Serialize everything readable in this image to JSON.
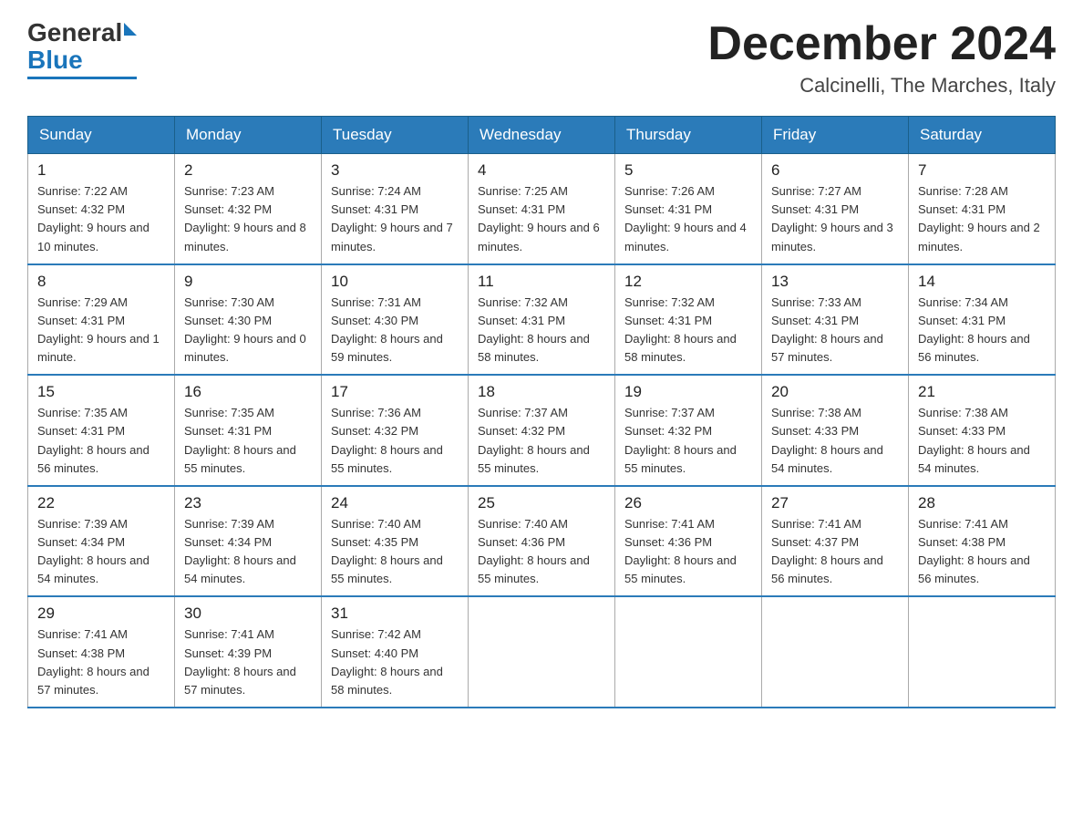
{
  "header": {
    "logo_general": "General",
    "logo_blue": "Blue",
    "month_year": "December 2024",
    "location": "Calcinelli, The Marches, Italy"
  },
  "days_of_week": [
    "Sunday",
    "Monday",
    "Tuesday",
    "Wednesday",
    "Thursday",
    "Friday",
    "Saturday"
  ],
  "weeks": [
    [
      {
        "day": 1,
        "sunrise": "7:22 AM",
        "sunset": "4:32 PM",
        "daylight": "9 hours and 10 minutes."
      },
      {
        "day": 2,
        "sunrise": "7:23 AM",
        "sunset": "4:32 PM",
        "daylight": "9 hours and 8 minutes."
      },
      {
        "day": 3,
        "sunrise": "7:24 AM",
        "sunset": "4:31 PM",
        "daylight": "9 hours and 7 minutes."
      },
      {
        "day": 4,
        "sunrise": "7:25 AM",
        "sunset": "4:31 PM",
        "daylight": "9 hours and 6 minutes."
      },
      {
        "day": 5,
        "sunrise": "7:26 AM",
        "sunset": "4:31 PM",
        "daylight": "9 hours and 4 minutes."
      },
      {
        "day": 6,
        "sunrise": "7:27 AM",
        "sunset": "4:31 PM",
        "daylight": "9 hours and 3 minutes."
      },
      {
        "day": 7,
        "sunrise": "7:28 AM",
        "sunset": "4:31 PM",
        "daylight": "9 hours and 2 minutes."
      }
    ],
    [
      {
        "day": 8,
        "sunrise": "7:29 AM",
        "sunset": "4:31 PM",
        "daylight": "9 hours and 1 minute."
      },
      {
        "day": 9,
        "sunrise": "7:30 AM",
        "sunset": "4:30 PM",
        "daylight": "9 hours and 0 minutes."
      },
      {
        "day": 10,
        "sunrise": "7:31 AM",
        "sunset": "4:30 PM",
        "daylight": "8 hours and 59 minutes."
      },
      {
        "day": 11,
        "sunrise": "7:32 AM",
        "sunset": "4:31 PM",
        "daylight": "8 hours and 58 minutes."
      },
      {
        "day": 12,
        "sunrise": "7:32 AM",
        "sunset": "4:31 PM",
        "daylight": "8 hours and 58 minutes."
      },
      {
        "day": 13,
        "sunrise": "7:33 AM",
        "sunset": "4:31 PM",
        "daylight": "8 hours and 57 minutes."
      },
      {
        "day": 14,
        "sunrise": "7:34 AM",
        "sunset": "4:31 PM",
        "daylight": "8 hours and 56 minutes."
      }
    ],
    [
      {
        "day": 15,
        "sunrise": "7:35 AM",
        "sunset": "4:31 PM",
        "daylight": "8 hours and 56 minutes."
      },
      {
        "day": 16,
        "sunrise": "7:35 AM",
        "sunset": "4:31 PM",
        "daylight": "8 hours and 55 minutes."
      },
      {
        "day": 17,
        "sunrise": "7:36 AM",
        "sunset": "4:32 PM",
        "daylight": "8 hours and 55 minutes."
      },
      {
        "day": 18,
        "sunrise": "7:37 AM",
        "sunset": "4:32 PM",
        "daylight": "8 hours and 55 minutes."
      },
      {
        "day": 19,
        "sunrise": "7:37 AM",
        "sunset": "4:32 PM",
        "daylight": "8 hours and 55 minutes."
      },
      {
        "day": 20,
        "sunrise": "7:38 AM",
        "sunset": "4:33 PM",
        "daylight": "8 hours and 54 minutes."
      },
      {
        "day": 21,
        "sunrise": "7:38 AM",
        "sunset": "4:33 PM",
        "daylight": "8 hours and 54 minutes."
      }
    ],
    [
      {
        "day": 22,
        "sunrise": "7:39 AM",
        "sunset": "4:34 PM",
        "daylight": "8 hours and 54 minutes."
      },
      {
        "day": 23,
        "sunrise": "7:39 AM",
        "sunset": "4:34 PM",
        "daylight": "8 hours and 54 minutes."
      },
      {
        "day": 24,
        "sunrise": "7:40 AM",
        "sunset": "4:35 PM",
        "daylight": "8 hours and 55 minutes."
      },
      {
        "day": 25,
        "sunrise": "7:40 AM",
        "sunset": "4:36 PM",
        "daylight": "8 hours and 55 minutes."
      },
      {
        "day": 26,
        "sunrise": "7:41 AM",
        "sunset": "4:36 PM",
        "daylight": "8 hours and 55 minutes."
      },
      {
        "day": 27,
        "sunrise": "7:41 AM",
        "sunset": "4:37 PM",
        "daylight": "8 hours and 56 minutes."
      },
      {
        "day": 28,
        "sunrise": "7:41 AM",
        "sunset": "4:38 PM",
        "daylight": "8 hours and 56 minutes."
      }
    ],
    [
      {
        "day": 29,
        "sunrise": "7:41 AM",
        "sunset": "4:38 PM",
        "daylight": "8 hours and 57 minutes."
      },
      {
        "day": 30,
        "sunrise": "7:41 AM",
        "sunset": "4:39 PM",
        "daylight": "8 hours and 57 minutes."
      },
      {
        "day": 31,
        "sunrise": "7:42 AM",
        "sunset": "4:40 PM",
        "daylight": "8 hours and 58 minutes."
      },
      null,
      null,
      null,
      null
    ]
  ]
}
